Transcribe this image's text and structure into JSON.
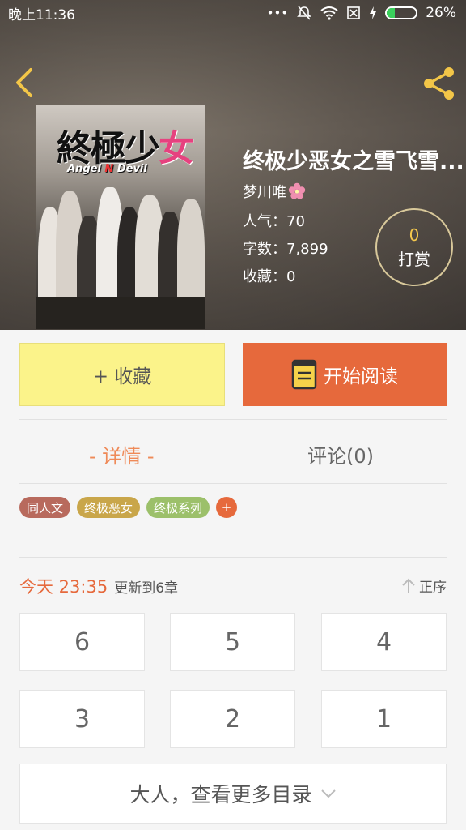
{
  "status_bar": {
    "time": "晚上11:36",
    "dots": "•••",
    "battery_text": "26%",
    "battery_level": 0.26
  },
  "book": {
    "title": "终极少恶女之雪飞雪...",
    "author": "梦川唯",
    "popularity": "人气：70",
    "word_count": "字数：7,899",
    "favorites": "收藏：0",
    "cover": {
      "title_main": "終極少",
      "title_accent": "女",
      "subtitle_a": "Angel ",
      "subtitle_n": "N",
      "subtitle_b": " Devil"
    }
  },
  "tip": {
    "count": "0",
    "label": "打赏"
  },
  "actions": {
    "collect_label": "+ 收藏",
    "read_label": "开始阅读"
  },
  "tabs": {
    "detail": "- 详情 -",
    "comment": "评论(0)"
  },
  "tags": [
    {
      "label": "同人文",
      "color": "#b86a5d"
    },
    {
      "label": "终极恶女",
      "color": "#c9a64a"
    },
    {
      "label": "终极系列",
      "color": "#9cc06a"
    }
  ],
  "tag_add": "+",
  "update": {
    "time": "今天 23:35",
    "text": "更新到6章",
    "sort_label": "正序"
  },
  "chapters": [
    "6",
    "5",
    "4",
    "3",
    "2",
    "1"
  ],
  "more_label": "大人，查看更多目录",
  "colors": {
    "accent": "#e6693c",
    "collect_bg": "#fbf38a",
    "tip_count": "#f5c84d"
  }
}
